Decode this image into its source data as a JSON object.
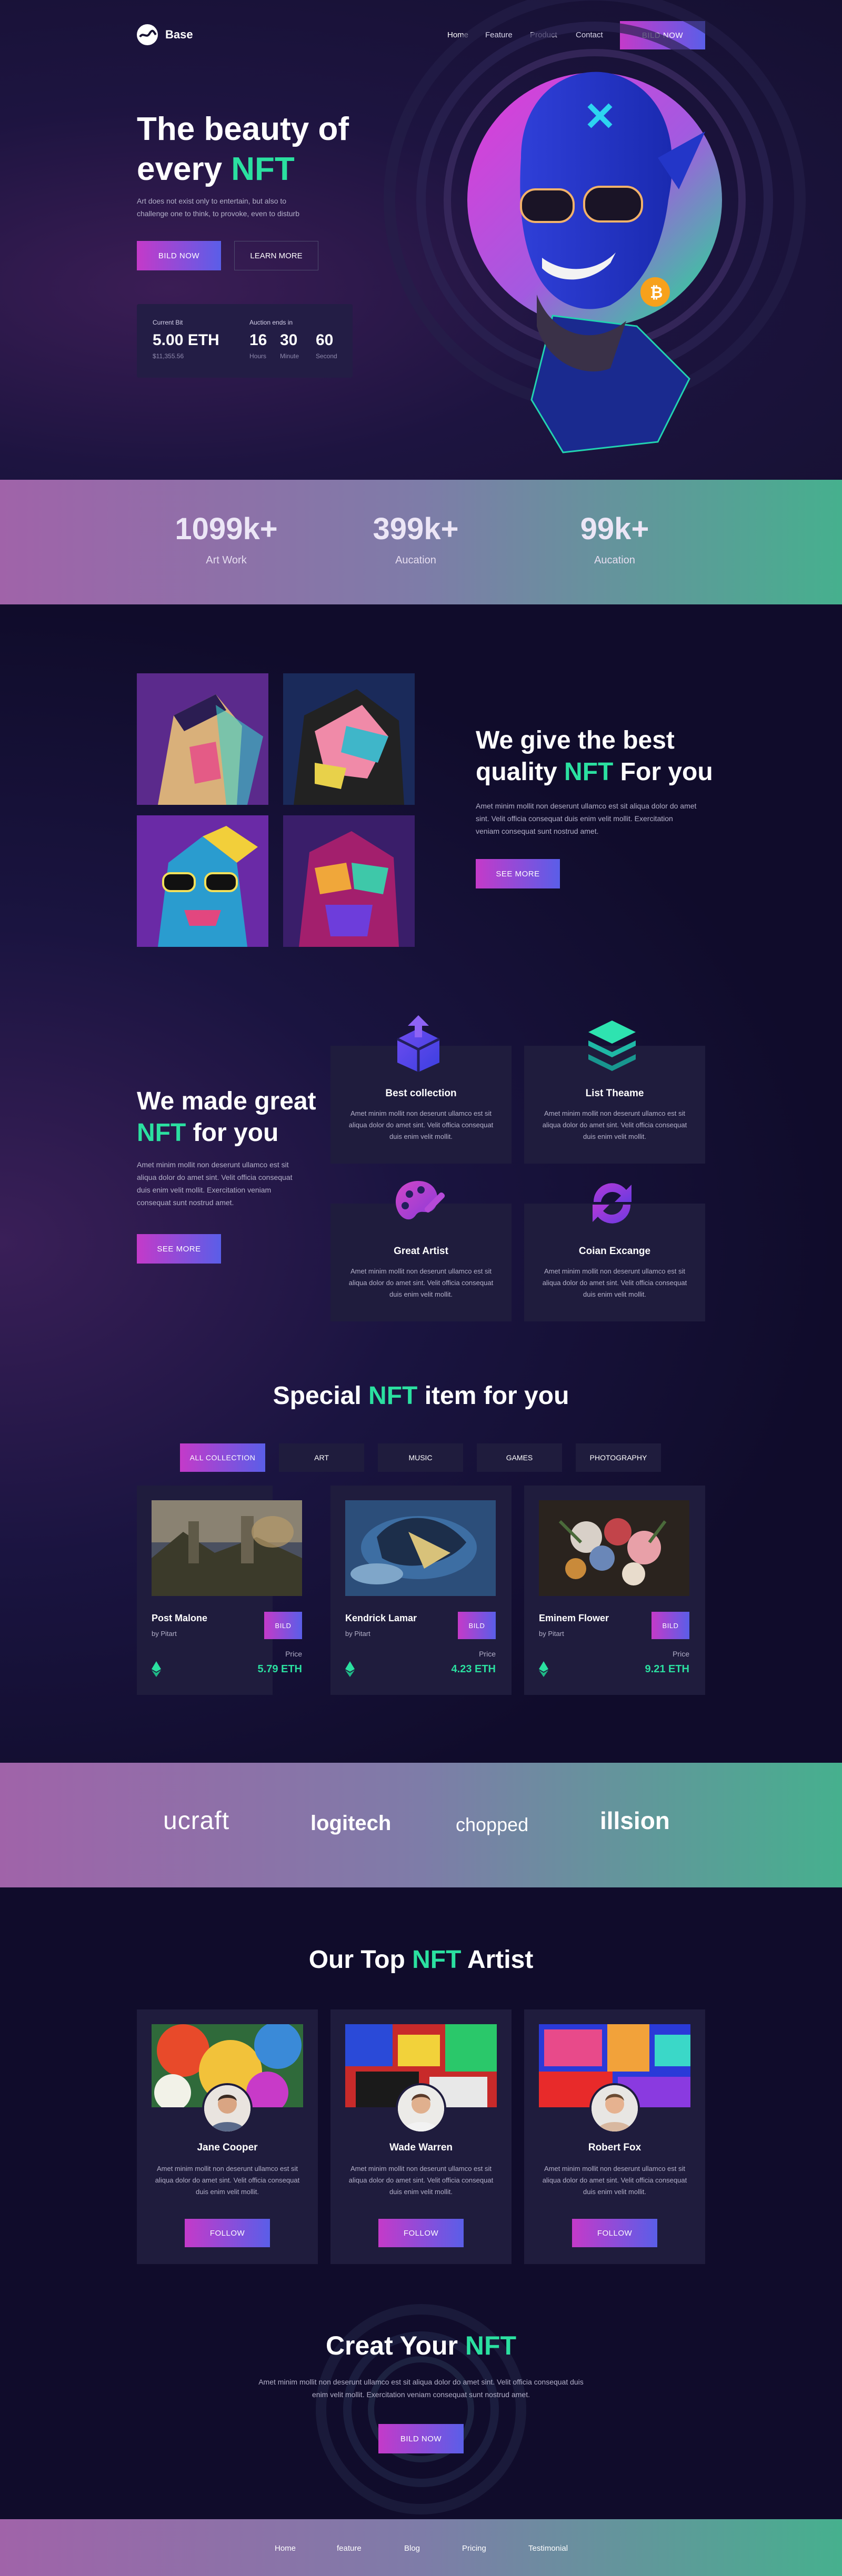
{
  "brand": {
    "name": "Base"
  },
  "nav": {
    "items": [
      "Home",
      "Feature",
      "Product",
      "Contact"
    ],
    "bid_now": "BILD NOW"
  },
  "hero": {
    "title_line1": "The beauty of",
    "title_line2_prefix": "every ",
    "title_highlight": "NFT",
    "subtitle": "Art does not exist only to entertain, but also to challenge one to think, to provoke, even to disturb",
    "primary_button": "BILD NOW",
    "secondary_button": "LEARN MORE",
    "current_bid": {
      "label": "Current Bit",
      "value": "5.00 ETH",
      "sub": "$11,355.56"
    },
    "auction": {
      "label": "Auction ends in",
      "hours": "16",
      "hours_label": "Hours",
      "minutes": "30",
      "minutes_label": "Minute",
      "seconds": "60",
      "seconds_label": "Second"
    }
  },
  "stats": [
    {
      "value": "1099k+",
      "label": "Art Work"
    },
    {
      "value": "399k+",
      "label": "Aucation"
    },
    {
      "value": "99k+",
      "label": "Aucation"
    }
  ],
  "quality": {
    "title_line1": "We give the best",
    "title_line2_prefix": "quality ",
    "title_highlight": "NFT",
    "title_line2_suffix": " For you",
    "text": "Amet minim mollit non deserunt ullamco est sit aliqua dolor do amet sint. Velit officia consequat duis enim velit mollit. Exercitation veniam consequat sunt nostrud amet.",
    "button": "SEE MORE"
  },
  "made": {
    "title_line1": "We made great",
    "title_highlight": "NFT",
    "title_line2_suffix": " for you",
    "text": "Amet minim mollit non deserunt ullamco est sit aliqua dolor do amet sint. Velit officia consequat duis enim velit mollit. Exercitation veniam consequat sunt nostrud amet.",
    "button": "SEE MORE",
    "features": [
      {
        "title": "Best collection",
        "text": "Amet minim mollit non deserunt ullamco est sit aliqua dolor do amet sint. Velit officia consequat duis enim velit mollit.",
        "icon": "box-icon"
      },
      {
        "title": "List Theame",
        "text": "Amet minim mollit non deserunt ullamco est sit aliqua dolor do amet sint. Velit officia consequat duis enim velit mollit.",
        "icon": "layers-icon"
      },
      {
        "title": "Great Artist",
        "text": "Amet minim mollit non deserunt ullamco est sit aliqua dolor do amet sint. Velit officia consequat duis enim velit mollit.",
        "icon": "palette-icon"
      },
      {
        "title": "Coian Excange",
        "text": "Amet minim mollit non deserunt ullamco est sit aliqua dolor do amet sint. Velit officia consequat duis enim velit mollit.",
        "icon": "exchange-icon"
      }
    ]
  },
  "special": {
    "title_prefix": "Special ",
    "title_highlight": "NFT",
    "title_suffix": " item for you",
    "tabs": [
      "ALL COLLECTION",
      "ART",
      "MUSIC",
      "GAMES",
      "PHOTOGRAPHY"
    ],
    "items": [
      {
        "name": "Post Malone",
        "by": "by Pitart",
        "bid": "BILD",
        "price_label": "Price",
        "price": "5.79 ETH"
      },
      {
        "name": "Kendrick Lamar",
        "by": "by Pitart",
        "bid": "BILD",
        "price_label": "Price",
        "price": "4.23 ETH"
      },
      {
        "name": "Eminem Flower",
        "by": "by Pitart",
        "bid": "BILD",
        "price_label": "Price",
        "price": "9.21 ETH"
      }
    ]
  },
  "partners": [
    "ucraft",
    "logitech",
    "chopped",
    "illsion"
  ],
  "artists": {
    "title_prefix": "Our Top ",
    "title_highlight": "NFT",
    "title_suffix": " Artist",
    "items": [
      {
        "name": "Jane Cooper",
        "text": "Amet minim mollit non deserunt ullamco est sit aliqua dolor do amet sint. Velit officia consequat duis enim velit mollit.",
        "button": "FOLLOW"
      },
      {
        "name": "Wade Warren",
        "text": "Amet minim mollit non deserunt ullamco est sit aliqua dolor do amet sint. Velit officia consequat duis enim velit mollit.",
        "button": "FOLLOW"
      },
      {
        "name": "Robert Fox",
        "text": "Amet minim mollit non deserunt ullamco est sit aliqua dolor do amet sint. Velit officia consequat duis enim velit mollit.",
        "button": "FOLLOW"
      }
    ]
  },
  "cta": {
    "title_prefix": "Creat Your ",
    "title_highlight": "NFT",
    "text": "Amet minim mollit non deserunt ullamco est sit aliqua dolor do amet sint. Velit officia consequat duis enim velit mollit. Exercitation veniam consequat sunt nostrud amet.",
    "button": "BILD NOW"
  },
  "footer": {
    "items": [
      "Home",
      "feature",
      "Blog",
      "Pricing",
      "Testimonial"
    ]
  }
}
